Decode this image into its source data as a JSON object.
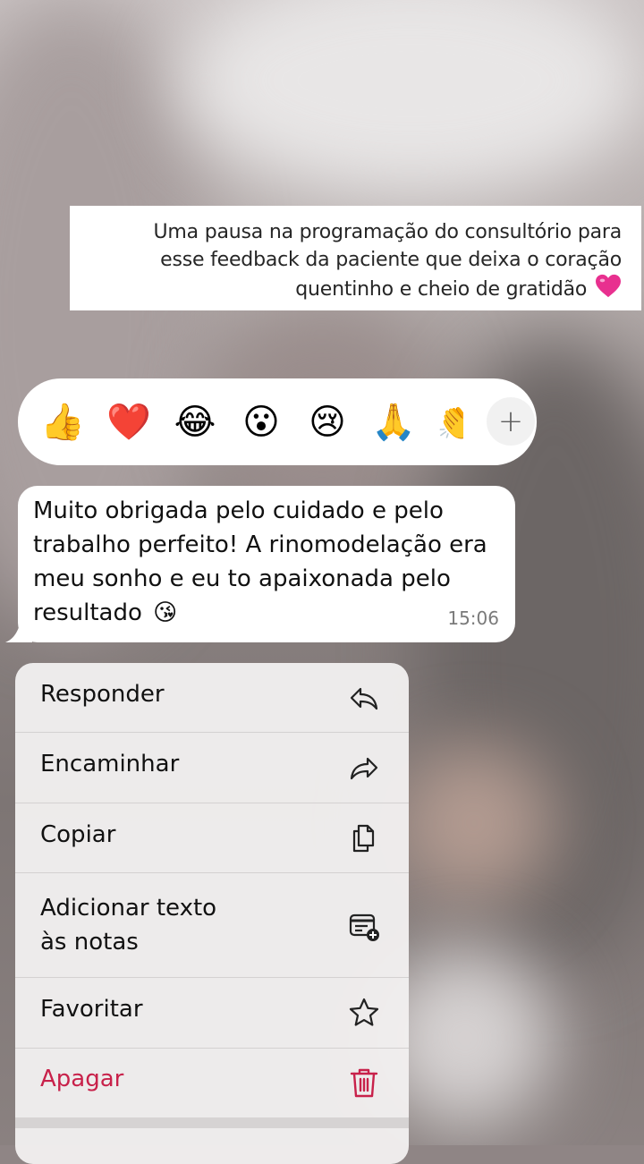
{
  "caption": {
    "lines": [
      "Uma pausa na programação do consultório para",
      "esse feedback da paciente que deixa o coração",
      "quentinho e cheio de gratidão"
    ],
    "heart_icon": "pink-heart-icon"
  },
  "reactions": {
    "items": [
      "👍",
      "❤️",
      "😂",
      "😮",
      "😢",
      "🙏",
      "👏"
    ],
    "icons": [
      "thumbs-up",
      "red-heart",
      "tears-of-joy",
      "surprised-face",
      "crying-face",
      "folded-hands",
      "clapping-hands"
    ],
    "more_label": "+"
  },
  "message": {
    "lines": [
      "Muito obrigada pelo cuidado e pelo",
      "trabalho perfeito! A rinomodelação era",
      "meu sonho e eu to apaixonada pelo",
      "resultado"
    ],
    "emoji": "😘",
    "time": "15:06"
  },
  "menu": {
    "items": [
      {
        "label": "Responder",
        "icon": "reply-icon"
      },
      {
        "label": "Encaminhar",
        "icon": "forward-icon"
      },
      {
        "label": "Copiar",
        "icon": "copy-icon"
      },
      {
        "label_line1": "Adicionar texto",
        "label_line2": "às notas",
        "icon": "add-note-icon"
      },
      {
        "label": "Favoritar",
        "icon": "star-icon"
      },
      {
        "label": "Apagar",
        "icon": "trash-icon"
      }
    ]
  },
  "colors": {
    "danger": "#c8214a",
    "caption_heart": "#e8308f",
    "bubble": "#ffffff"
  }
}
